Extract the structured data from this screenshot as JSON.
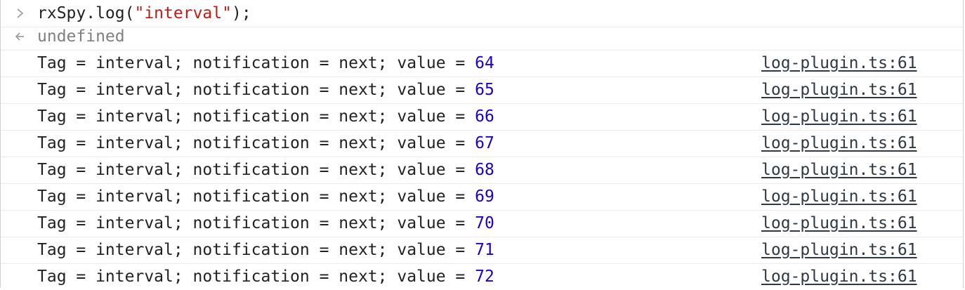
{
  "input": {
    "prefix": "rxSpy.log(",
    "string": "\"interval\"",
    "suffix": ");"
  },
  "result": {
    "text": "undefined"
  },
  "log_rows": [
    {
      "prefix": "Tag = interval; notification = next; value = ",
      "value": "64",
      "source": "log-plugin.ts:61"
    },
    {
      "prefix": "Tag = interval; notification = next; value = ",
      "value": "65",
      "source": "log-plugin.ts:61"
    },
    {
      "prefix": "Tag = interval; notification = next; value = ",
      "value": "66",
      "source": "log-plugin.ts:61"
    },
    {
      "prefix": "Tag = interval; notification = next; value = ",
      "value": "67",
      "source": "log-plugin.ts:61"
    },
    {
      "prefix": "Tag = interval; notification = next; value = ",
      "value": "68",
      "source": "log-plugin.ts:61"
    },
    {
      "prefix": "Tag = interval; notification = next; value = ",
      "value": "69",
      "source": "log-plugin.ts:61"
    },
    {
      "prefix": "Tag = interval; notification = next; value = ",
      "value": "70",
      "source": "log-plugin.ts:61"
    },
    {
      "prefix": "Tag = interval; notification = next; value = ",
      "value": "71",
      "source": "log-plugin.ts:61"
    },
    {
      "prefix": "Tag = interval; notification = next; value = ",
      "value": "72",
      "source": "log-plugin.ts:61"
    }
  ],
  "icons": {
    "prompt": "chevron-right-icon",
    "result": "return-arrow-icon"
  },
  "colors": {
    "string": "#c41a16",
    "number": "#1c00cf",
    "undefined": "#808080",
    "link": "#303942"
  }
}
